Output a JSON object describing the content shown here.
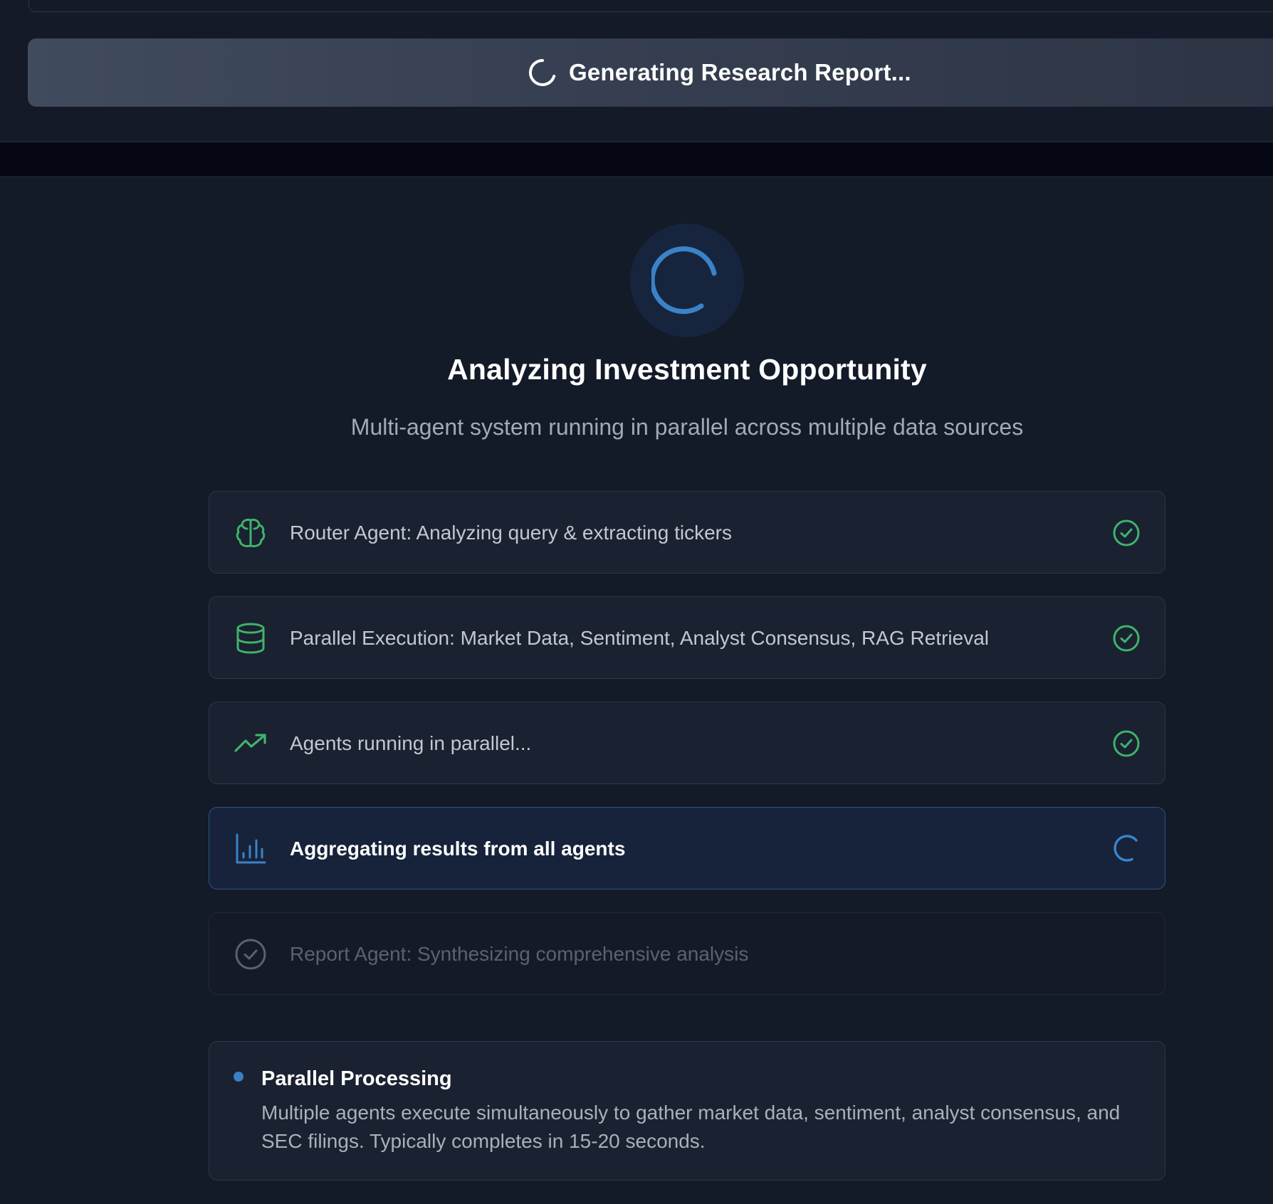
{
  "header": {
    "generate_button_label": "Generating Research Report..."
  },
  "hero": {
    "title": "Analyzing Investment Opportunity",
    "subtitle": "Multi-agent system running in parallel across multiple data sources"
  },
  "steps": [
    {
      "label": "Router Agent: Analyzing query & extracting tickers",
      "icon": "brain-icon",
      "status": "complete"
    },
    {
      "label": "Parallel Execution: Market Data, Sentiment, Analyst Consensus, RAG Retrieval",
      "icon": "database-icon",
      "status": "complete"
    },
    {
      "label": "Agents running in parallel...",
      "icon": "trending-up-icon",
      "status": "complete"
    },
    {
      "label": "Aggregating results from all agents",
      "icon": "bar-chart-icon",
      "status": "in-progress"
    },
    {
      "label": "Report Agent: Synthesizing comprehensive analysis",
      "icon": "check-circle-icon",
      "status": "pending"
    }
  ],
  "info": {
    "title": "Parallel Processing",
    "body": "Multiple agents execute simultaneously to gather market data, sentiment, analyst consensus, and SEC filings. Typically completes in 15-20 seconds."
  },
  "colors": {
    "success": "#3fb36b",
    "accent": "#3b7fc4",
    "background": "#131a28"
  }
}
